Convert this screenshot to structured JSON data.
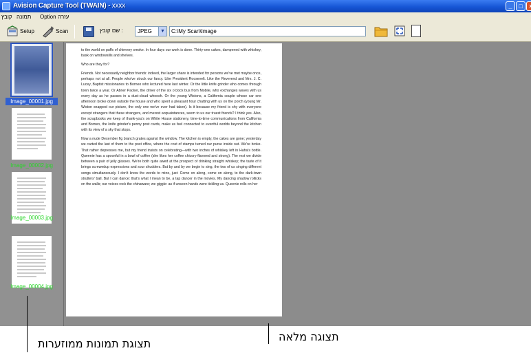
{
  "window": {
    "title": "Avision Capture Tool (TWAIN) - ",
    "title_suffix": "xxxx"
  },
  "menu": {
    "items": [
      "קובץ",
      "תמונה",
      "Option",
      "עזרה"
    ]
  },
  "toolbar": {
    "setup_label": "Setup",
    "scan_label": "Scan",
    "save_label": "שם קובץ :",
    "format_value": "JPEG",
    "path_value": "C:\\My Scan\\Image",
    "icons": [
      "setup-icon",
      "scan-icon",
      "save-icon",
      "dropdown-arrow-icon",
      "folder-icon",
      "fit-window-icon",
      "full-page-icon"
    ]
  },
  "thumbnails": {
    "items": [
      {
        "label": "Image_00001.jpg",
        "selected": true
      },
      {
        "label": "Image_00002.jpg",
        "selected": false
      },
      {
        "label": "Image_00003.jpg",
        "selected": false
      },
      {
        "label": "Image_00004.jpg",
        "selected": false
      }
    ]
  },
  "document": {
    "paragraphs": [
      "to the world on puffs of chimney smoke. In four days our work is done. Thirty-one cakes, dampened with whiskey, bask on windowsills and shelves.",
      "Who are they for?",
      "Friends. Not necessarily neighbor friends: indeed, the larger share is intended for persons we've met maybe once, perhaps not at all. People who've struck our fancy. Like President Roosevelt. Like the Reverend and Mrs. J. C. Lucey, Baptist missionaries to Borneo who lectured here last winter. Or the little knife grinder who comes through town twice a year. Or Abner Packer, the driver of the six o'clock bus from Mobile, who exchanges waves with us every day as he passes in a dust-cloud whoosh. Or the young Wistons, a California couple whose car one afternoon broke down outside the house and who spent a pleasant hour chatting with us on the porch (young Mr. Wiston snapped our picture, the only one we've ever had taken). Is it because my friend is shy with everyone except strangers that these strangers, and merest acquaintances, seem to us our truest friends? I think yes. Also, the scrapbooks we keep of thank-you's on White House stationery, time-to-time communications from California and Borneo, the knife grinder's penny post cards, make us feel connected to eventful worlds beyond the kitchen with its view of a sky that stops.",
      "Now a nude December fig branch grates against the window. The kitchen is empty, the cakes are gone; yesterday we carted the last of them to the post office, where the cost of stamps turned our purse inside out. We're broke. That rather depresses me, but my friend insists on celebrating—with two inches of whiskey left in Haha's bottle. Queenie has a spoonful in a bowl of coffee (she likes her coffee chicory-flavored and strong). The rest we divide between a pair of jelly glasses. We're both quite awed at the prospect of drinking straight whiskey; the taste of it brings screwedup expressions and sour shudders. But by and by we begin to sing, the two of us singing different songs simultaneously. I don't know the words to mine, just: Come on along, come on along, to the dark-town strutters' ball. But I can dance: that's what I mean to be, a tap dancer in the movies. My dancing shadow rollicks on the walls; our voices rock the chinaware; we giggle: as if unseen hands were tickling us. Queenie rolls on her"
    ]
  },
  "annotations": {
    "thumbnail_view": "תצוגת תמונות ממוזערות",
    "full_view": "תצוגה מלאה"
  },
  "colors": {
    "titlebar": "#1756d6",
    "chrome": "#ece9d8",
    "workspace": "#8c8c8c",
    "thumb_label": "#2ad52a",
    "selection": "#3160d0"
  }
}
